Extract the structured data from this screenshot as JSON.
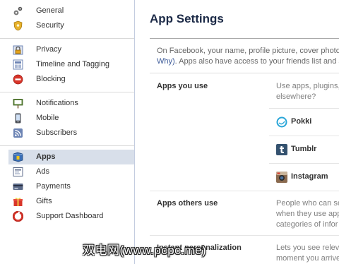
{
  "sidebar": {
    "groups": [
      {
        "items": [
          {
            "label": "General",
            "icon": "gears-icon"
          },
          {
            "label": "Security",
            "icon": "shield-icon"
          }
        ]
      },
      {
        "items": [
          {
            "label": "Privacy",
            "icon": "lock-icon"
          },
          {
            "label": "Timeline and Tagging",
            "icon": "timeline-icon"
          },
          {
            "label": "Blocking",
            "icon": "block-icon"
          }
        ]
      },
      {
        "items": [
          {
            "label": "Notifications",
            "icon": "notification-sign-icon"
          },
          {
            "label": "Mobile",
            "icon": "phone-icon"
          },
          {
            "label": "Subscribers",
            "icon": "rss-icon"
          }
        ]
      },
      {
        "items": [
          {
            "label": "Apps",
            "icon": "apps-icon",
            "active": true
          },
          {
            "label": "Ads",
            "icon": "ads-icon"
          },
          {
            "label": "Payments",
            "icon": "payments-icon"
          },
          {
            "label": "Gifts",
            "icon": "gift-icon"
          },
          {
            "label": "Support Dashboard",
            "icon": "lifebuoy-icon"
          }
        ]
      }
    ]
  },
  "main": {
    "title": "App Settings",
    "intro_line1": "On Facebook, your name, profile picture, cover photo",
    "intro_link": "Why)",
    "intro_line2_rest": ". Apps also have access to your friends list and a",
    "rows": [
      {
        "title": "Apps you use",
        "desc_line1": "Use apps, plugins,",
        "desc_line2": "elsewhere?",
        "apps": [
          {
            "name": "Pokki",
            "icon": "pokki-icon"
          },
          {
            "name": "Tumblr",
            "icon": "tumblr-icon"
          },
          {
            "name": "Instagram",
            "icon": "instagram-icon"
          }
        ]
      },
      {
        "title": "Apps others use",
        "desc_line1": "People who can se",
        "desc_line2": "when they use app",
        "desc_line3": "categories of infor"
      },
      {
        "title": "Instant personalization",
        "desc_line1": "Lets you see relev",
        "desc_line2": "moment you arrive"
      }
    ]
  },
  "watermark": "双电网(www.pcpc.me)",
  "colors": {
    "accent": "#3b5998",
    "active_bg": "#d8dfea",
    "title": "#1c2a47",
    "muted_text": "#808080"
  }
}
